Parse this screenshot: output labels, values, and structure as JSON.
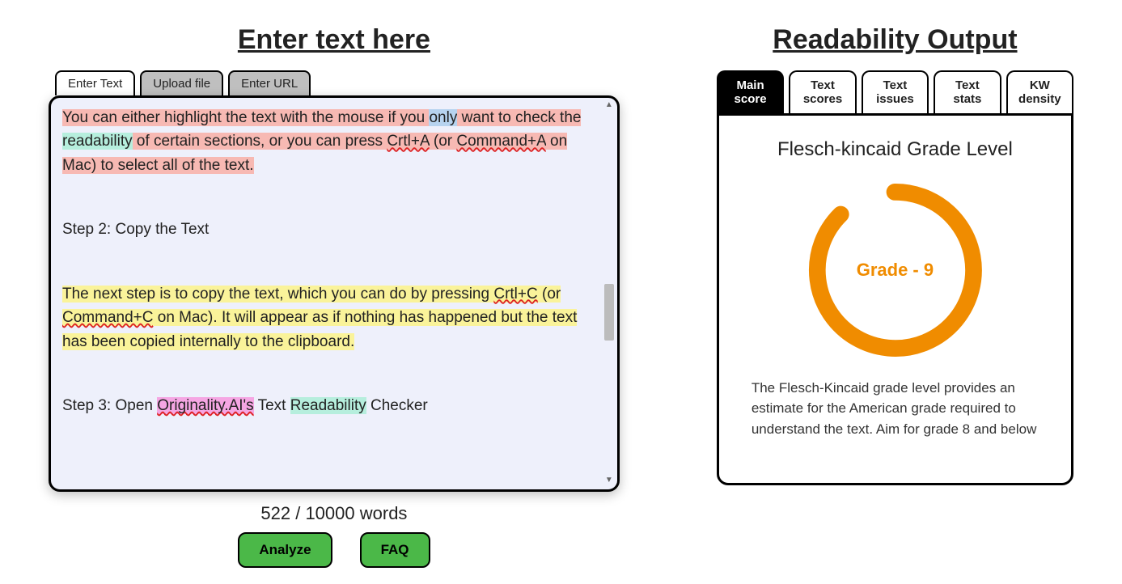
{
  "left": {
    "title": "Enter text here",
    "tabs": {
      "enter_text": "Enter Text",
      "upload_file": "Upload file",
      "enter_url": "Enter URL"
    },
    "word_count": "522 / 10000 words",
    "buttons": {
      "analyze": "Analyze",
      "faq": "FAQ"
    },
    "text": {
      "p1_a": "You can either highlight the text with the mouse if you ",
      "p1_only": "only",
      "p1_b": " want to check the ",
      "p1_readability": "readability",
      "p1_c": " of certain sections, or you can press ",
      "p1_crtl_a": "Crtl+A",
      "p1_d": " (or ",
      "p1_cmd_a": "Command+A",
      "p1_e": " on Mac) to select all of the text.",
      "step2": "Step 2: Copy the Text",
      "p2_a": "The next step is to copy the text, which you can do by pressing ",
      "p2_crtl_c": "Crtl+C",
      "p2_b": " (or ",
      "p2_cmd_c": "Command+C",
      "p2_c": " on Mac). It will appear as if nothing has happened but the text has been copied internally to the clipboard.",
      "step3_a": "Step 3: Open ",
      "step3_orig": "Originality.AI's",
      "step3_b": " Text ",
      "step3_read": "Readability",
      "step3_c": " Checker"
    }
  },
  "right": {
    "title": "Readability Output",
    "tabs": {
      "main_l1": "Main",
      "main_l2": "score",
      "tscores_l1": "Text",
      "tscores_l2": "scores",
      "tissues_l1": "Text",
      "tissues_l2": "issues",
      "tstats_l1": "Text",
      "tstats_l2": "stats",
      "kw_l1": "KW",
      "kw_l2": "density"
    },
    "gauge": {
      "title": "Flesch-kincaid Grade Level",
      "center": "Grade - 9",
      "desc": "The Flesch-Kincaid grade level provides an estimate for the American grade required to understand the text. Aim for grade 8 and below"
    }
  }
}
